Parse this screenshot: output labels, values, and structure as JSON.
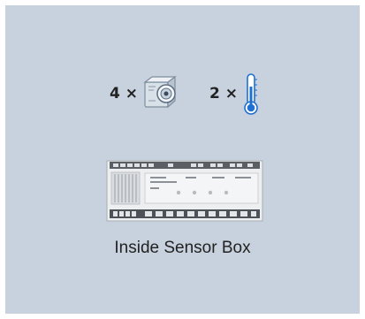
{
  "counts": {
    "sensor_label": "4 ×",
    "thermo_label": "2 ×"
  },
  "icons": {
    "sensor": "radiation-sensor-icon",
    "thermometer": "thermometer-icon",
    "device": "sensor-box-icon"
  },
  "caption": "Inside Sensor Box",
  "colors": {
    "panel": "#c8d2de",
    "thermometer_accent": "#1f6fd1"
  }
}
